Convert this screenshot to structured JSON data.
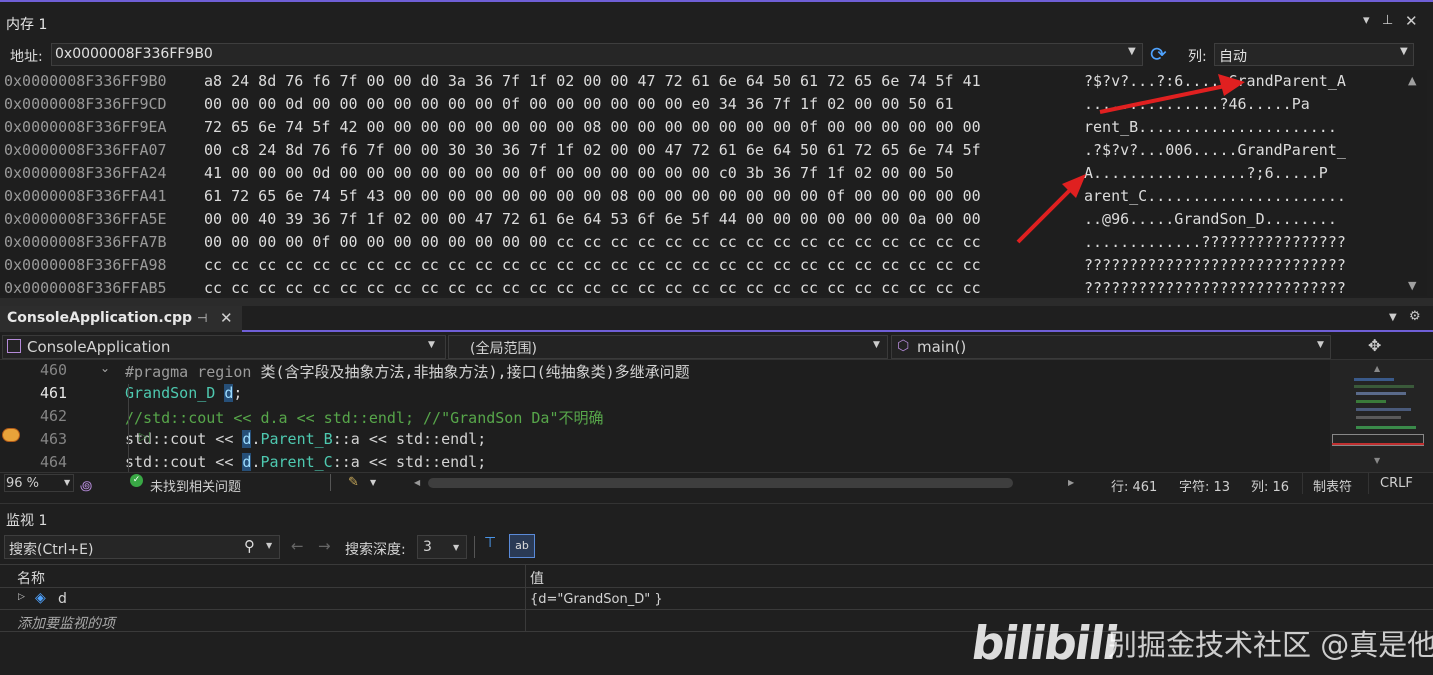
{
  "memory_window": {
    "title": "内存 1",
    "address_label": "地址:",
    "address_value": "0x0000008F336FF9B0",
    "columns_label": "列:",
    "columns_value": "自动",
    "rows": [
      {
        "addr": "0x0000008F336FF9B0",
        "hex": "a8 24 8d 76 f6 7f 00 00 d0 3a 36 7f 1f 02 00 00 47 72 61 6e 64 50 61 72 65 6e 74 5f 41",
        "ascii": "?$?v?...?:6.....GrandParent_A"
      },
      {
        "addr": "0x0000008F336FF9CD",
        "hex": "00 00 00 0d 00 00 00 00 00 00 00 0f 00 00 00 00 00 00 e0 34 36 7f 1f 02 00 00 50 61",
        "ascii": "...............?46.....Pa"
      },
      {
        "addr": "0x0000008F336FF9EA",
        "hex": "72 65 6e 74 5f 42 00 00 00 00 00 00 00 00 08 00 00 00 00 00 00 00 0f 00 00 00 00 00 00",
        "ascii": "rent_B......................"
      },
      {
        "addr": "0x0000008F336FFA07",
        "hex": "00 c8 24 8d 76 f6 7f 00 00 30 30 36 7f 1f 02 00 00 47 72 61 6e 64 50 61 72 65 6e 74 5f",
        "ascii": ".?$?v?...006.....GrandParent_"
      },
      {
        "addr": "0x0000008F336FFA24",
        "hex": "41 00 00 00 0d 00 00 00 00 00 00 00 0f 00 00 00 00 00 00 c0 3b 36 7f 1f 02 00 00 50",
        "ascii": "A.................?;6.....P"
      },
      {
        "addr": "0x0000008F336FFA41",
        "hex": "61 72 65 6e 74 5f 43 00 00 00 00 00 00 00 00 08 00 00 00 00 00 00 00 0f 00 00 00 00 00",
        "ascii": "arent_C......................"
      },
      {
        "addr": "0x0000008F336FFA5E",
        "hex": "00 00 40 39 36 7f 1f 02 00 00 47 72 61 6e 64 53 6f 6e 5f 44 00 00 00 00 00 00 0a 00 00",
        "ascii": "..@96.....GrandSon_D........"
      },
      {
        "addr": "0x0000008F336FFA7B",
        "hex": "00 00 00 00 0f 00 00 00 00 00 00 00 00 cc cc cc cc cc cc cc cc cc cc cc cc cc cc cc cc",
        "ascii": ".............????????????????"
      },
      {
        "addr": "0x0000008F336FFA98",
        "hex": "cc cc cc cc cc cc cc cc cc cc cc cc cc cc cc cc cc cc cc cc cc cc cc cc cc cc cc cc cc",
        "ascii": "?????????????????????????????"
      },
      {
        "addr": "0x0000008F336FFAB5",
        "hex": "cc cc cc cc cc cc cc cc cc cc cc cc cc cc cc cc cc cc cc cc cc cc cc cc cc cc cc cc cc",
        "ascii": "?????????????????????????????"
      }
    ]
  },
  "editor": {
    "file_tab": "ConsoleApplication.cpp",
    "project_dropdown": "ConsoleApplication",
    "scope_dropdown": "(全局范围)",
    "function_dropdown": "main()",
    "lines": [
      {
        "num": "460",
        "text": "#pragma region 类(含字段及抽象方法,非抽象方法),接口(纯抽象类)多继承问题"
      },
      {
        "num": "461",
        "text": "GrandSon_D d;"
      },
      {
        "num": "462",
        "text": "//std::cout << d.a << std::endl; //\"GrandSon Da\"不明确"
      },
      {
        "num": "463",
        "text": "std::cout << d.Parent_B::a << std::endl;"
      },
      {
        "num": "464",
        "text": "std::cout << d.Parent_C::a << std::endl;"
      }
    ],
    "status": {
      "zoom": "96 %",
      "issues": "未找到相关问题",
      "row": "行: 461",
      "char": "字符: 13",
      "col": "列: 16",
      "tab": "制表符",
      "eol": "CRLF"
    }
  },
  "watch": {
    "title": "监视 1",
    "search_placeholder": "搜索(Ctrl+E)",
    "depth_label": "搜索深度:",
    "depth_value": "3",
    "col_name": "名称",
    "col_value": "值",
    "items": [
      {
        "name": "d",
        "value": "{d=\"GrandSon_D\" }"
      }
    ],
    "add_item": "添加要监视的项"
  },
  "watermark": {
    "logo": "bilibili",
    "text": "别掘金技术社区 @真是他D"
  },
  "colors": {
    "accent": "#6f5fd6",
    "arrow": "#e02020",
    "keyword": "#569cd6",
    "type": "#4ec9b0",
    "comment": "#57a64a",
    "string": "#d69d85"
  }
}
